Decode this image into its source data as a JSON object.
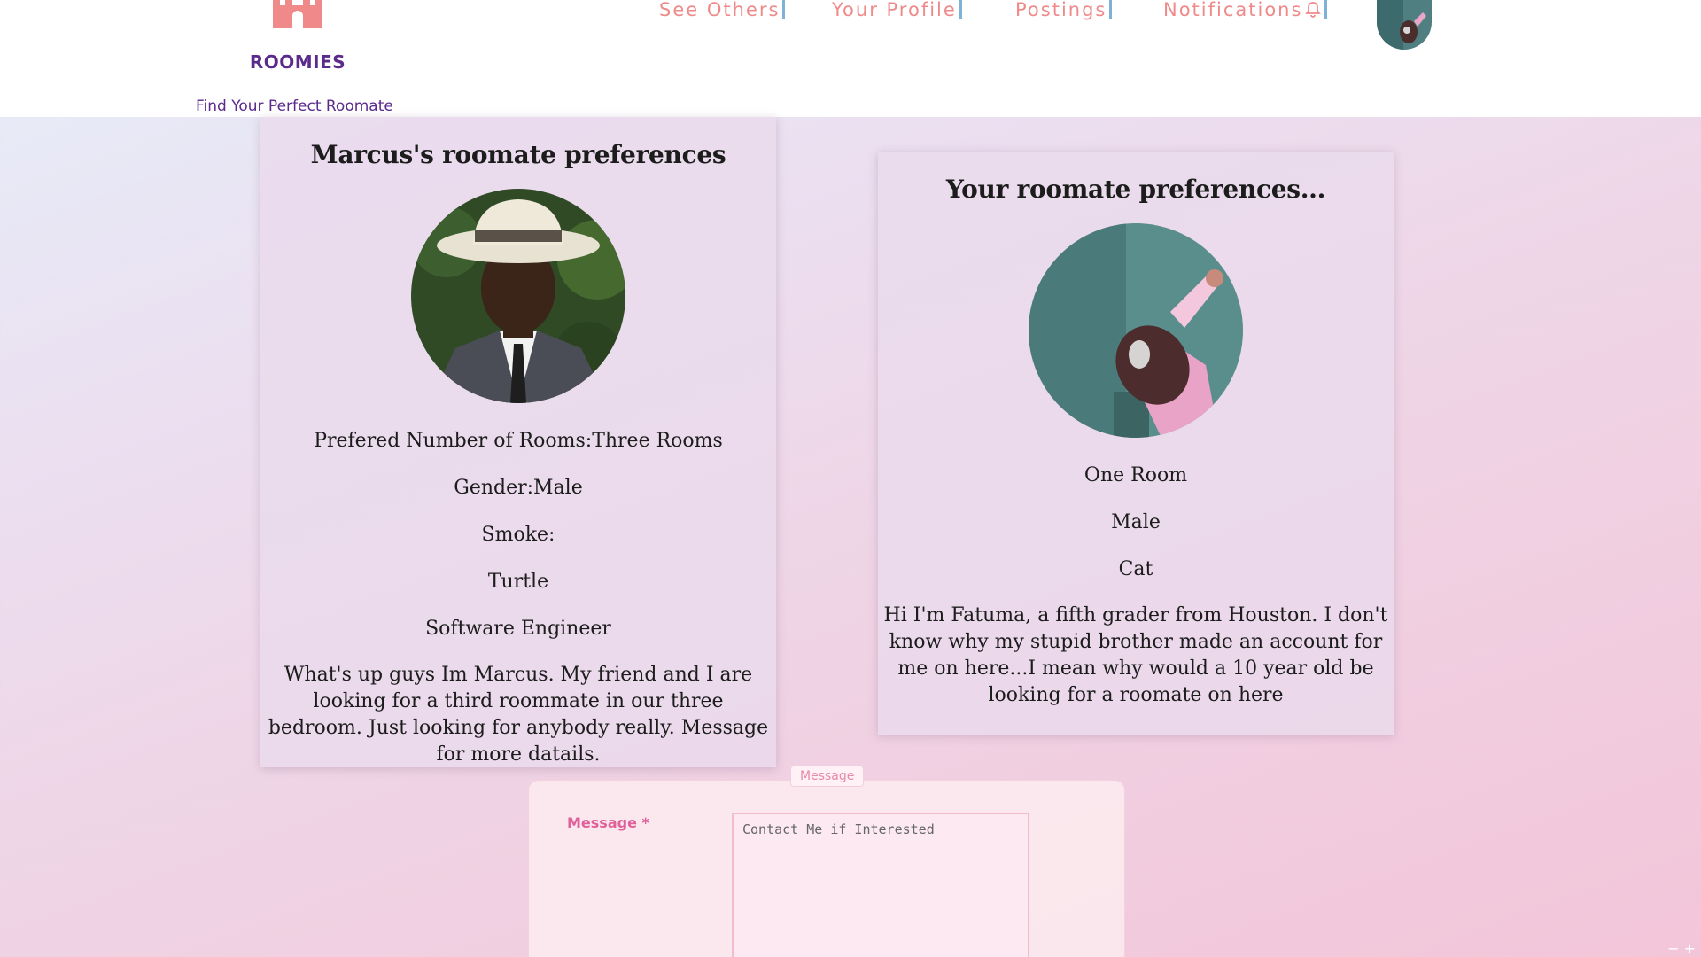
{
  "brand": {
    "name": "ROOMIES",
    "tagline": "Find Your Perfect Roomate",
    "logo_icon": "castle-icon",
    "logo_color": "#f08a8a"
  },
  "nav": {
    "items": [
      {
        "label": "See Others"
      },
      {
        "label": "Your Profile"
      },
      {
        "label": "Postings"
      },
      {
        "label": "Notifications",
        "icon": "bell-icon"
      }
    ],
    "link_color": "#f08a8a",
    "divider_color": "#7fb0d6",
    "avatar": "user-avatar"
  },
  "other_card": {
    "title": "Marcus's roomate preferences",
    "rooms": "Prefered Number of Rooms:Three Rooms",
    "gender": "Gender:Male",
    "smoke": "Smoke:",
    "pet": "Turtle",
    "occupation": "Software Engineer",
    "bio": "What's up guys Im Marcus. My friend and I are looking for a third roommate in our three bedroom. Just looking for anybody really. Message for more datails."
  },
  "your_card": {
    "title": "Your roomate preferences...",
    "rooms": "One Room",
    "gender": "Male",
    "pet": "Cat",
    "bio": "Hi I'm Fatuma, a fifth grader from Houston. I don't know why my stupid brother made an account for me on here...I mean why would a 10 year old be looking for a roomate on here"
  },
  "message_form": {
    "legend": "Message",
    "label": "Message *",
    "placeholder": "Contact Me if Interested"
  },
  "zoom_control": "− +"
}
